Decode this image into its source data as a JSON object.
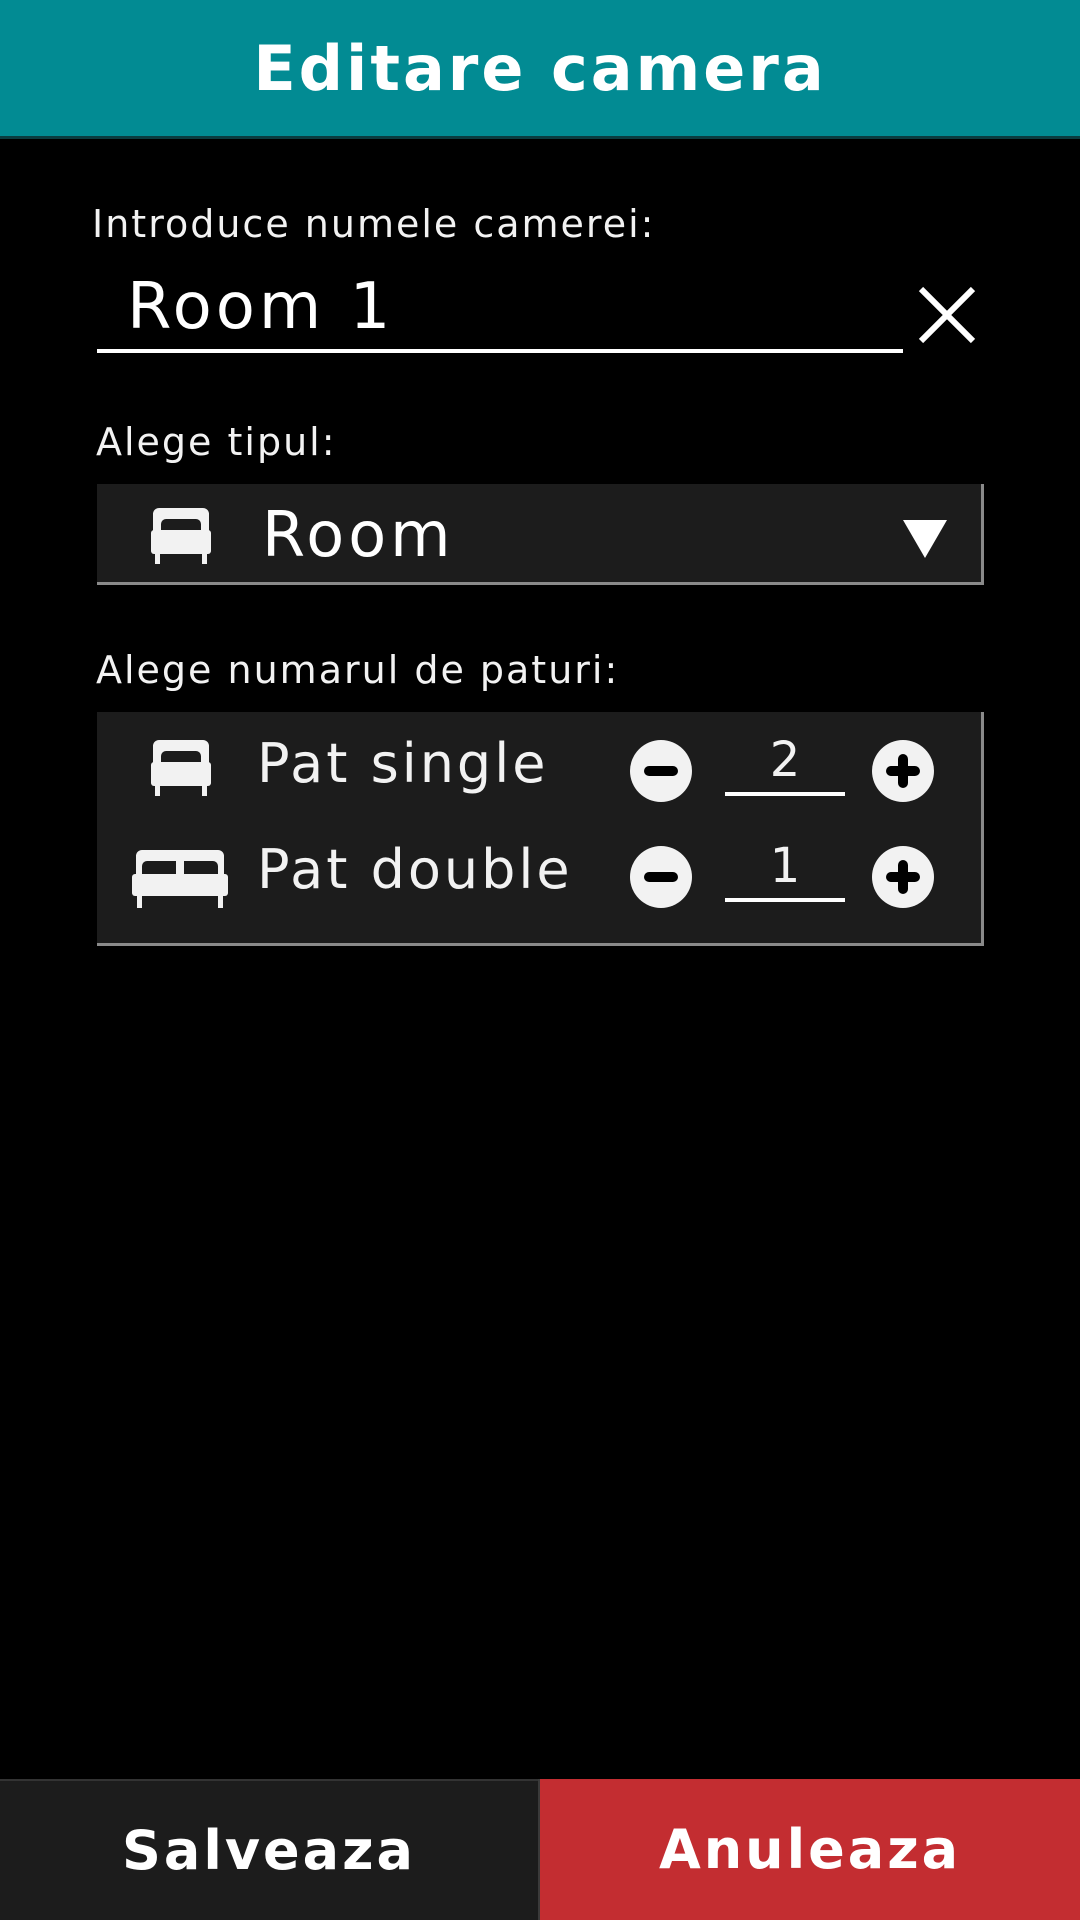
{
  "header": {
    "title": "Editare camera"
  },
  "name_section": {
    "label": "Introduce numele camerei:",
    "value": "Room 1",
    "clear_icon": "close-icon"
  },
  "type_section": {
    "label": "Alege tipul:",
    "selected": "Room",
    "icon": "single-bed-icon",
    "arrow_icon": "dropdown-triangle-icon"
  },
  "beds_section": {
    "label": "Alege numarul de paturi:",
    "rows": [
      {
        "label": "Pat single",
        "count": "2",
        "icon": "single-bed-icon"
      },
      {
        "label": "Pat double",
        "count": "1",
        "icon": "double-bed-icon"
      }
    ]
  },
  "footer": {
    "save_label": "Salveaza",
    "cancel_label": "Anuleaza",
    "save_color": "#1c1c1c",
    "cancel_color": "#c32d31"
  },
  "colors": {
    "header": "#028b93",
    "background": "#000000",
    "panel": "#1c1c1c"
  }
}
